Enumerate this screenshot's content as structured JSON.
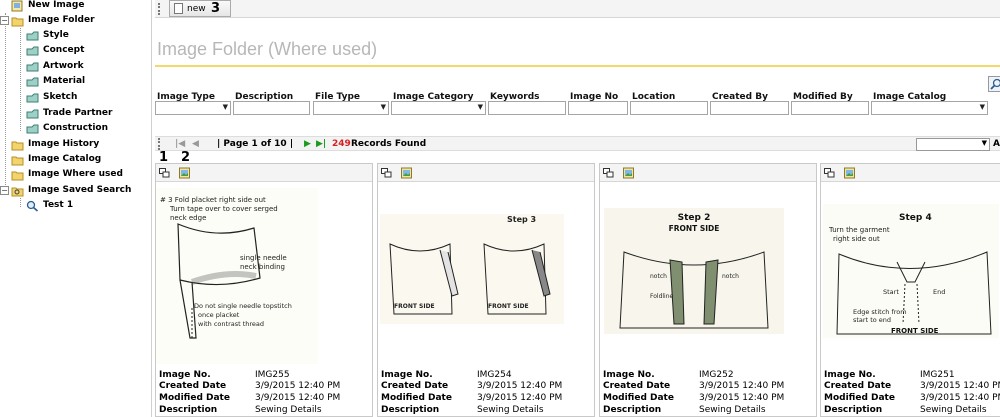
{
  "sidebar": {
    "items": [
      {
        "label": "New Image"
      },
      {
        "label": "Image Folder"
      },
      {
        "label": "Style"
      },
      {
        "label": "Concept"
      },
      {
        "label": "Artwork"
      },
      {
        "label": "Material"
      },
      {
        "label": "Sketch"
      },
      {
        "label": "Trade Partner"
      },
      {
        "label": "Construction"
      },
      {
        "label": "Image History"
      },
      {
        "label": "Image Catalog"
      },
      {
        "label": "Image Where used"
      },
      {
        "label": "Image Saved Search"
      },
      {
        "label": "Test 1"
      }
    ]
  },
  "toolbar": {
    "new_label": "new"
  },
  "annotations": {
    "a1": "1",
    "a2": "2",
    "a3": "3"
  },
  "page": {
    "title": "Image Folder (Where used)"
  },
  "filters": {
    "image_type": "Image Type",
    "description": "Description",
    "file_type": "File Type",
    "image_category": "Image Category",
    "keywords": "Keywords",
    "image_no": "Image No",
    "location": "Location",
    "created_by": "Created By",
    "modified_by": "Modified By",
    "image_catalog": "Image Catalog"
  },
  "pager": {
    "page_text": "| Page 1 of 10 |",
    "count": "249",
    "records_found": "Records Found",
    "page_size_suffix": "A"
  },
  "meta_labels": {
    "image_no": "Image No.",
    "created": "Created Date",
    "modified": "Modified Date",
    "description": "Description"
  },
  "cards": [
    {
      "image_no": "IMG255",
      "created": "3/9/2015 12:40 PM",
      "modified": "3/9/2015 12:40 PM",
      "description": "Sewing Details",
      "sketch": [
        "# 3  Fold placket right side out",
        "Turn tape over to cover serged",
        "neck edge",
        "single needle",
        "neck binding",
        "Do not single needle topstitch",
        "once placket",
        "with contrast thread"
      ]
    },
    {
      "image_no": "IMG254",
      "created": "3/9/2015 12:40 PM",
      "modified": "3/9/2015 12:40 PM",
      "description": "Sewing Details",
      "sketch": [
        "Step 3",
        "FRONT SIDE",
        "FRONT SIDE"
      ]
    },
    {
      "image_no": "IMG252",
      "created": "3/9/2015 12:40 PM",
      "modified": "3/9/2015 12:40 PM",
      "description": "Sewing Details",
      "sketch": [
        "Step 2",
        "FRONT SIDE",
        "notch",
        "Foldline",
        "notch"
      ]
    },
    {
      "image_no": "IMG251",
      "created": "3/9/2015 12:40 PM",
      "modified": "3/9/2015 12:40 PM",
      "description": "Sewing Details",
      "sketch": [
        "Step 4",
        "Turn the garment",
        "right side out",
        "Start",
        "End",
        "Edge stitch from",
        "start to end",
        "FRONT SIDE"
      ]
    }
  ]
}
